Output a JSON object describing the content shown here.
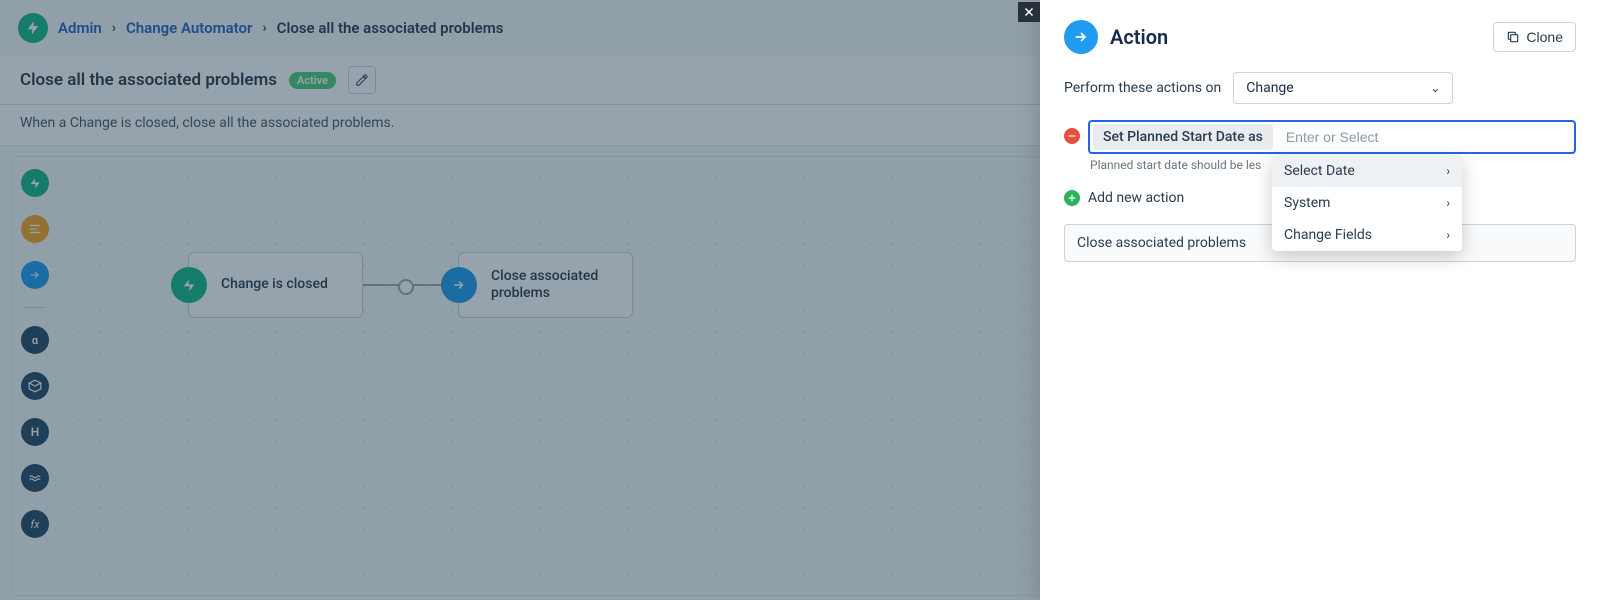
{
  "breadcrumb": {
    "admin": "Admin",
    "automator": "Change Automator",
    "current": "Close all the associated problems"
  },
  "title": {
    "text": "Close all the associated problems",
    "status": "Active"
  },
  "description": "When a Change is closed, close all the associated problems.",
  "flow": {
    "event_label": "Change is closed",
    "action_label": "Close associated problems"
  },
  "panel": {
    "title": "Action",
    "clone": "Clone",
    "perform_label": "Perform these actions on",
    "perform_value": "Change",
    "action_chip": "Set Planned Start Date as",
    "action_placeholder": "Enter or Select",
    "hint": "Planned start date should be les",
    "add_action": "Add new action",
    "associated": "Close associated problems",
    "dropdown": {
      "select_date": "Select Date",
      "system": "System",
      "change_fields": "Change Fields"
    }
  }
}
